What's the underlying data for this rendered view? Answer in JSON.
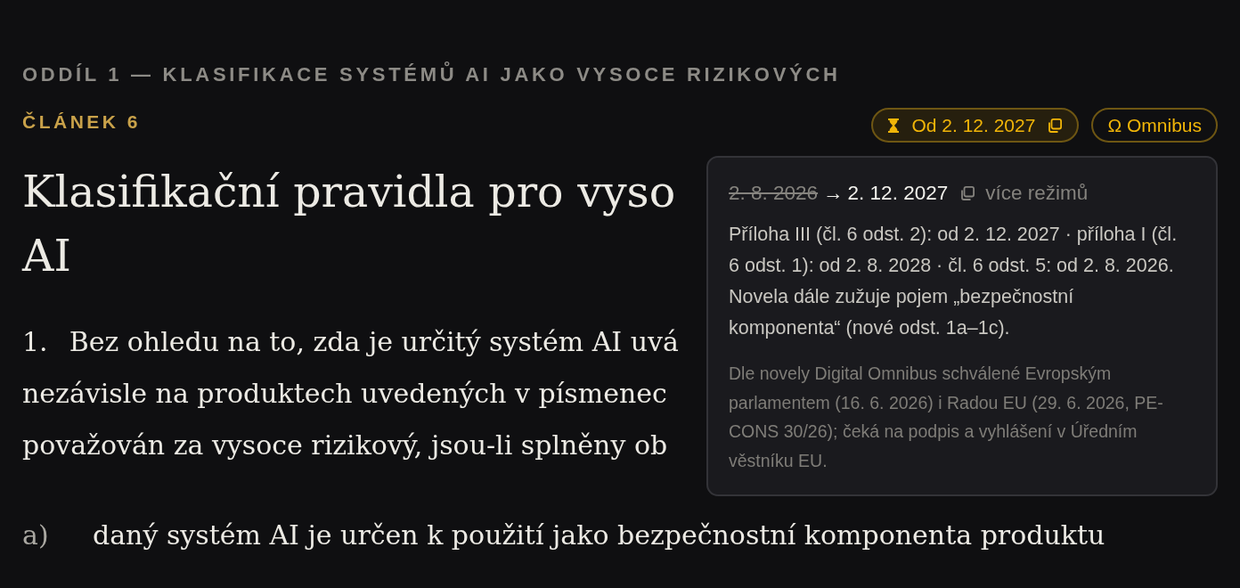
{
  "section_heading": "ODDÍL 1 — KLASIFIKACE SYSTÉMŮ AI JAKO VYSOCE RIZIKOVÝCH",
  "article_label": "ČLÁNEK 6",
  "badges": [
    {
      "kind": "date",
      "label": "Od 2. 12. 2027",
      "expanded": true
    },
    {
      "kind": "amendment",
      "label": "Ω Omnibus",
      "expanded": false
    }
  ],
  "article_title_lines": [
    "Klasifikační pravidla pro vyso",
    "AI"
  ],
  "paragraph": {
    "number": "1.",
    "lines": [
      "Bez ohledu na to, zda je určitý systém AI uvá",
      "nezávisle na produktech uvedených v písmenec",
      "považován za vysoce rizikový, jsou-li splněny ob"
    ]
  },
  "points": [
    {
      "marker": "a)",
      "lines": [
        "daný systém AI je určen k použití jako bezpečnostní komponenta produktu"
      ]
    }
  ],
  "popover": {
    "old_date": "2. 8. 2026",
    "arrow": "→",
    "new_date": "2. 12. 2027",
    "more_link": "více režimů",
    "details": "Příloha III (čl. 6 odst. 2): od 2. 12. 2027 · příloha I (čl. 6 odst. 1): od 2. 8. 2028 · čl. 6 odst. 5: od 2. 8. 2026. Novela dále zužuje pojem „bezpečnostní komponenta“ (nové odst. 1a–1c).",
    "note": "Dle novely Digital Omnibus schválené Evropským parlamentem (16. 6. 2026) i Radou EU (29. 6. 2026, PE-CONS 30/26); čeká na podpis a vyhlášení v Úředním věstníku EU."
  }
}
